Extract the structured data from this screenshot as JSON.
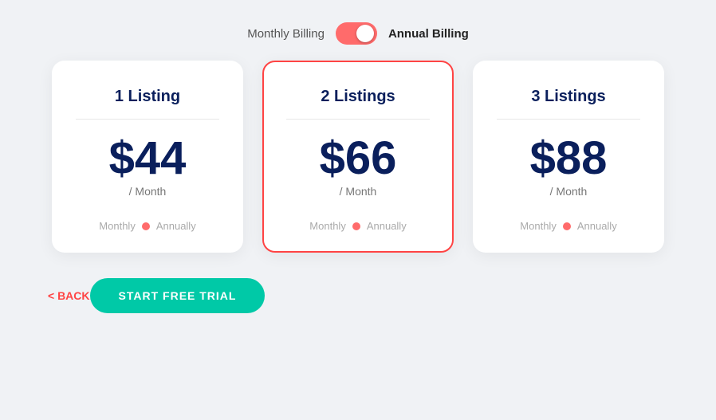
{
  "header": {
    "monthly_billing_label": "Monthly Billing",
    "annual_billing_label": "Annual Billing"
  },
  "toggle": {
    "active": "annual"
  },
  "cards": [
    {
      "id": "card-1",
      "title": "1 Listing",
      "price": "$44",
      "period": "/ Month",
      "monthly_label": "Monthly",
      "annually_label": "Annually",
      "selected": false
    },
    {
      "id": "card-2",
      "title": "2 Listings",
      "price": "$66",
      "period": "/ Month",
      "monthly_label": "Monthly",
      "annually_label": "Annually",
      "selected": true
    },
    {
      "id": "card-3",
      "title": "3 Listings",
      "price": "$88",
      "period": "/ Month",
      "monthly_label": "Monthly",
      "annually_label": "Annually",
      "selected": false
    }
  ],
  "footer": {
    "back_label": "< BACK",
    "cta_label": "START FREE TRIAL"
  }
}
